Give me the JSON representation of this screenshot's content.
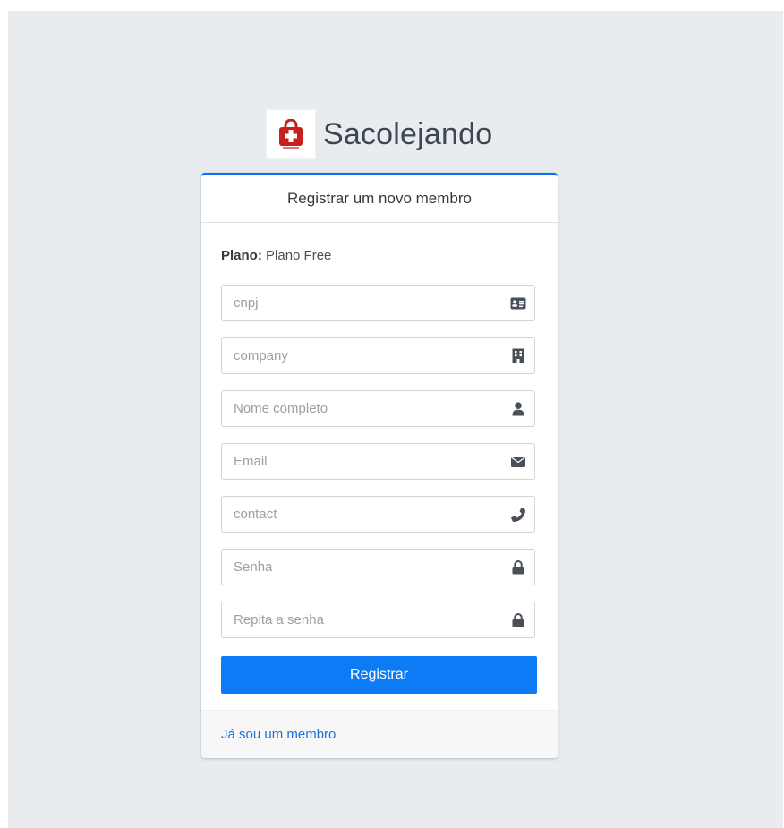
{
  "brand": {
    "name": "Sacolejando",
    "logo_icon": "shopping-bag-logo-icon",
    "logo_color": "#c8201e"
  },
  "card": {
    "header": "Registrar um novo membro",
    "plan_label": "Plano:",
    "plan_value": "Plano Free"
  },
  "form": {
    "fields": [
      {
        "name": "cnpj",
        "placeholder": "cnpj",
        "value": "",
        "icon": "id-card-icon"
      },
      {
        "name": "company",
        "placeholder": "company",
        "value": "",
        "icon": "building-icon"
      },
      {
        "name": "fullname",
        "placeholder": "Nome completo",
        "value": "",
        "icon": "user-icon"
      },
      {
        "name": "email",
        "placeholder": "Email",
        "value": "",
        "icon": "envelope-icon"
      },
      {
        "name": "contact",
        "placeholder": "contact",
        "value": "",
        "icon": "phone-icon"
      },
      {
        "name": "password",
        "placeholder": "Senha",
        "value": "",
        "icon": "lock-icon"
      },
      {
        "name": "password-confirm",
        "placeholder": "Repita a senha",
        "value": "",
        "icon": "lock-icon"
      }
    ],
    "submit_label": "Registrar",
    "submit_color": "#0d7bf5"
  },
  "footer": {
    "link_label": "Já sou um membro"
  },
  "colors": {
    "accent": "#0d6efd",
    "background": "#e9ecef",
    "link": "#1c6fd8"
  }
}
